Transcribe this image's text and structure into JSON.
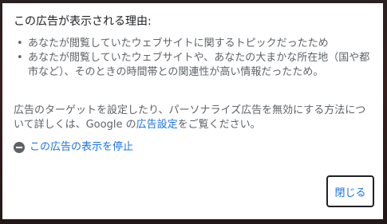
{
  "dialog": {
    "title": "この広告が表示される理由:",
    "reasons": [
      "あなたが閲覧していたウェブサイトに関するトピックだったため",
      "あなたが閲覧していたウェブサイトや、あなたの大まかな所在地（国や都市など）、そのときの時間帯との関連性が高い情報だったため。"
    ],
    "info_text_before": "広告のターゲットを設定したり、パーソナライズ広告を無効にする方法について詳しくは、Google の",
    "info_link": "広告設定",
    "info_text_after": "をご覧ください。",
    "stop_label": "この広告の表示を停止",
    "close_label": "閉じる"
  },
  "colors": {
    "link": "#1a73e8",
    "body_text": "#5f6368",
    "title_text": "#202124"
  }
}
